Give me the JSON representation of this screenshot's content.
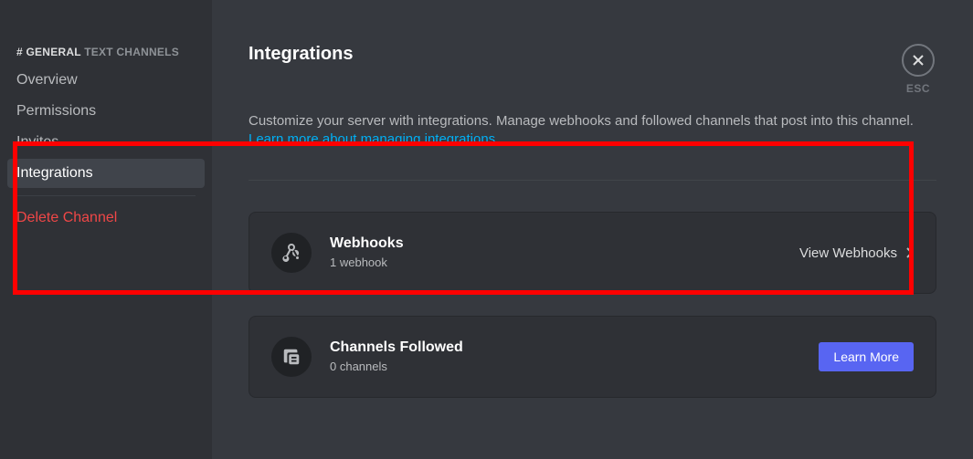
{
  "sidebar": {
    "channel_prefix": "# GENERAL",
    "channel_suffix": " TEXT CHANNELS",
    "items": [
      {
        "label": "Overview"
      },
      {
        "label": "Permissions"
      },
      {
        "label": "Invites"
      },
      {
        "label": "Integrations"
      },
      {
        "label": "Delete Channel"
      }
    ]
  },
  "page": {
    "title": "Integrations",
    "description": "Customize your server with integrations. Manage webhooks and followed channels that post into this channel.",
    "learn_more": "Learn more about managing integrations."
  },
  "cards": {
    "webhooks": {
      "title": "Webhooks",
      "subtitle": "1 webhook",
      "action": "View Webhooks"
    },
    "channels_followed": {
      "title": "Channels Followed",
      "subtitle": "0 channels",
      "action": "Learn More"
    }
  },
  "close": {
    "label": "ESC"
  }
}
